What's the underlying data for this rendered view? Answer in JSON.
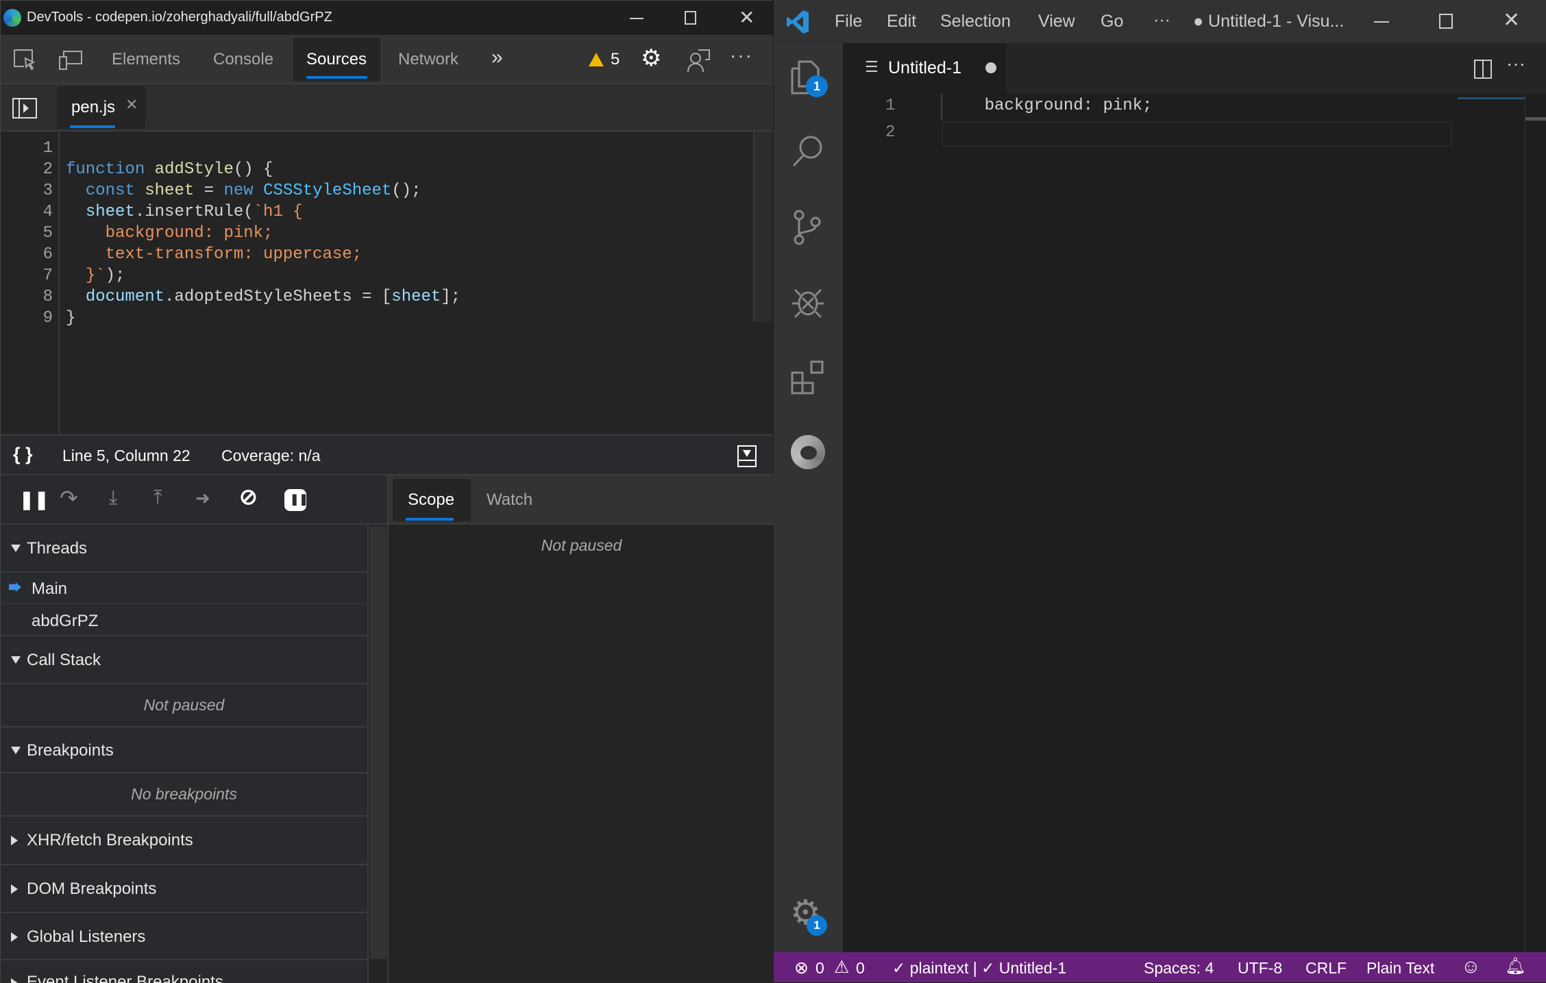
{
  "devtools": {
    "title": "DevTools - codepen.io/zoherghadyali/full/abdGrPZ",
    "tabs": [
      "Elements",
      "Console",
      "Sources",
      "Network"
    ],
    "active_tab": "Sources",
    "warning_count": "5",
    "file_tab": "pen.js",
    "code_lines": [
      [],
      [
        [
          "function",
          "kw"
        ],
        [
          " ",
          "pl"
        ],
        [
          "addStyle",
          "fn"
        ],
        [
          "() {",
          "pl"
        ]
      ],
      [
        [
          "  ",
          "pl"
        ],
        [
          "const",
          "kw"
        ],
        [
          " ",
          "pl"
        ],
        [
          "sheet",
          "fn"
        ],
        [
          " = ",
          "pl"
        ],
        [
          "new",
          "kw"
        ],
        [
          " ",
          "pl"
        ],
        [
          "CSSStyleSheet",
          "cls"
        ],
        [
          "();",
          "pl"
        ]
      ],
      [
        [
          "  ",
          "pl"
        ],
        [
          "sheet",
          "var"
        ],
        [
          ".insertRule(",
          "pl"
        ],
        [
          "`h1 {",
          "str"
        ]
      ],
      [
        [
          "    background: pink;",
          "str"
        ]
      ],
      [
        [
          "    text-transform: uppercase;",
          "str"
        ]
      ],
      [
        [
          "  ",
          "pl"
        ],
        [
          "}`",
          "str"
        ],
        [
          ");",
          "pl"
        ]
      ],
      [
        [
          "  ",
          "pl"
        ],
        [
          "document",
          "var"
        ],
        [
          ".adoptedStyleSheets = [",
          "pl"
        ],
        [
          "sheet",
          "var"
        ],
        [
          "];",
          "pl"
        ]
      ],
      [
        [
          "}",
          "pl"
        ]
      ]
    ],
    "status": {
      "position": "Line 5, Column 22",
      "coverage": "Coverage: n/a"
    },
    "debug_tabs": [
      "Scope",
      "Watch"
    ],
    "scope_message": "Not paused",
    "threads": {
      "label": "Threads",
      "items": [
        "Main",
        "abdGrPZ"
      ]
    },
    "call_stack": {
      "label": "Call Stack",
      "message": "Not paused"
    },
    "breakpoints": {
      "label": "Breakpoints",
      "message": "No breakpoints"
    },
    "collapsed_sections": [
      "XHR/fetch Breakpoints",
      "DOM Breakpoints",
      "Global Listeners",
      "Event Listener Breakpoints"
    ]
  },
  "vscode": {
    "menu": [
      "File",
      "Edit",
      "Selection",
      "View",
      "Go",
      "···"
    ],
    "title": "● Untitled-1 - Visu...",
    "tab": "Untitled-1",
    "explorer_badge": "1",
    "settings_badge": "1",
    "lines": [
      {
        "num": "1",
        "text": "    background: pink;"
      },
      {
        "num": "2",
        "text": ""
      }
    ],
    "statusbar": {
      "errors": "0",
      "warnings": "0",
      "checks": "✓ plaintext | ✓ Untitled-1",
      "spaces": "Spaces: 4",
      "encoding": "UTF-8",
      "eol": "CRLF",
      "language": "Plain Text"
    },
    "accent": "#68217a"
  }
}
